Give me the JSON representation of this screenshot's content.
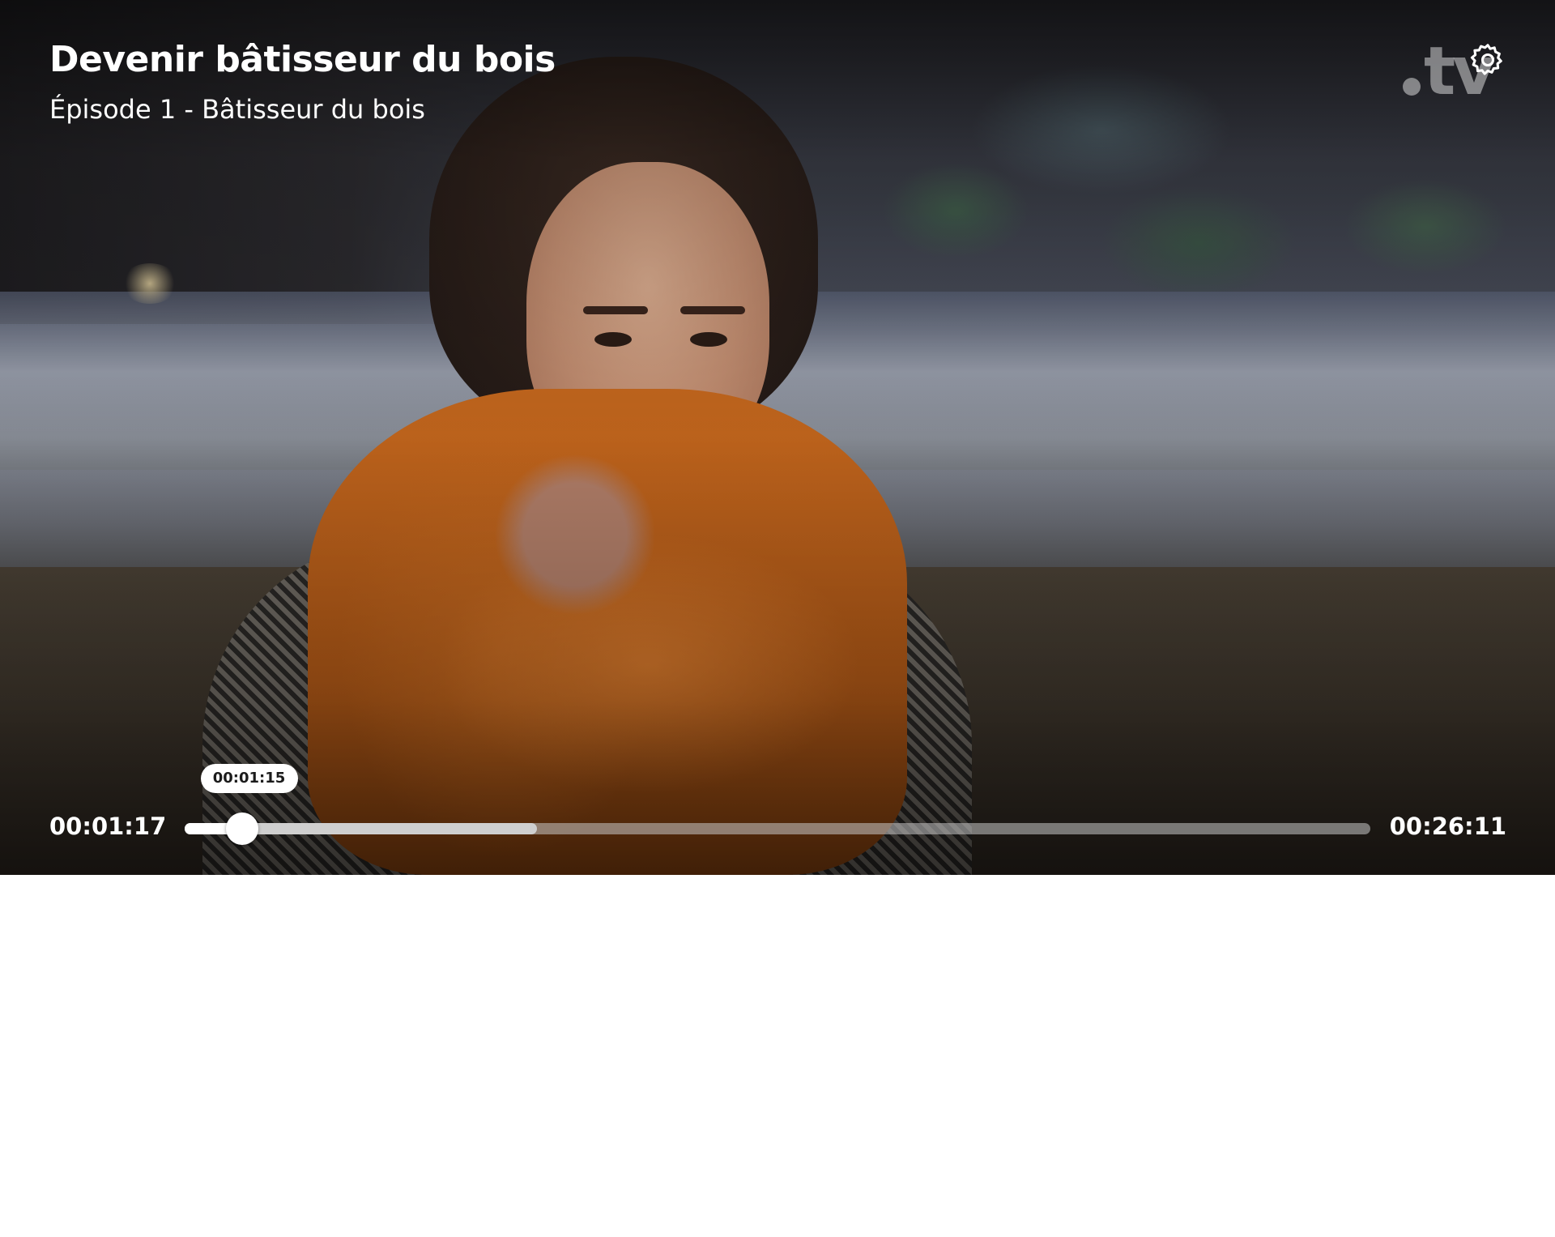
{
  "video": {
    "title": "Devenir bâtisseur du bois",
    "subtitle": "Épisode 1 - Bâtisseur du bois"
  },
  "branding": {
    "logo_text": "tv",
    "logo_icon": "france-tv-logo"
  },
  "controls": {
    "settings_icon": "gear-icon",
    "current_time": "00:01:17",
    "total_time": "00:26:11",
    "hover_time": "00:01:15",
    "played_fraction": 0.0488,
    "buffered_fraction": 0.297,
    "hover_fraction": 0.0475
  },
  "colors": {
    "overlay_text": "#ffffff",
    "progress_played": "#ffffff",
    "progress_track": "#c8c8c8"
  }
}
